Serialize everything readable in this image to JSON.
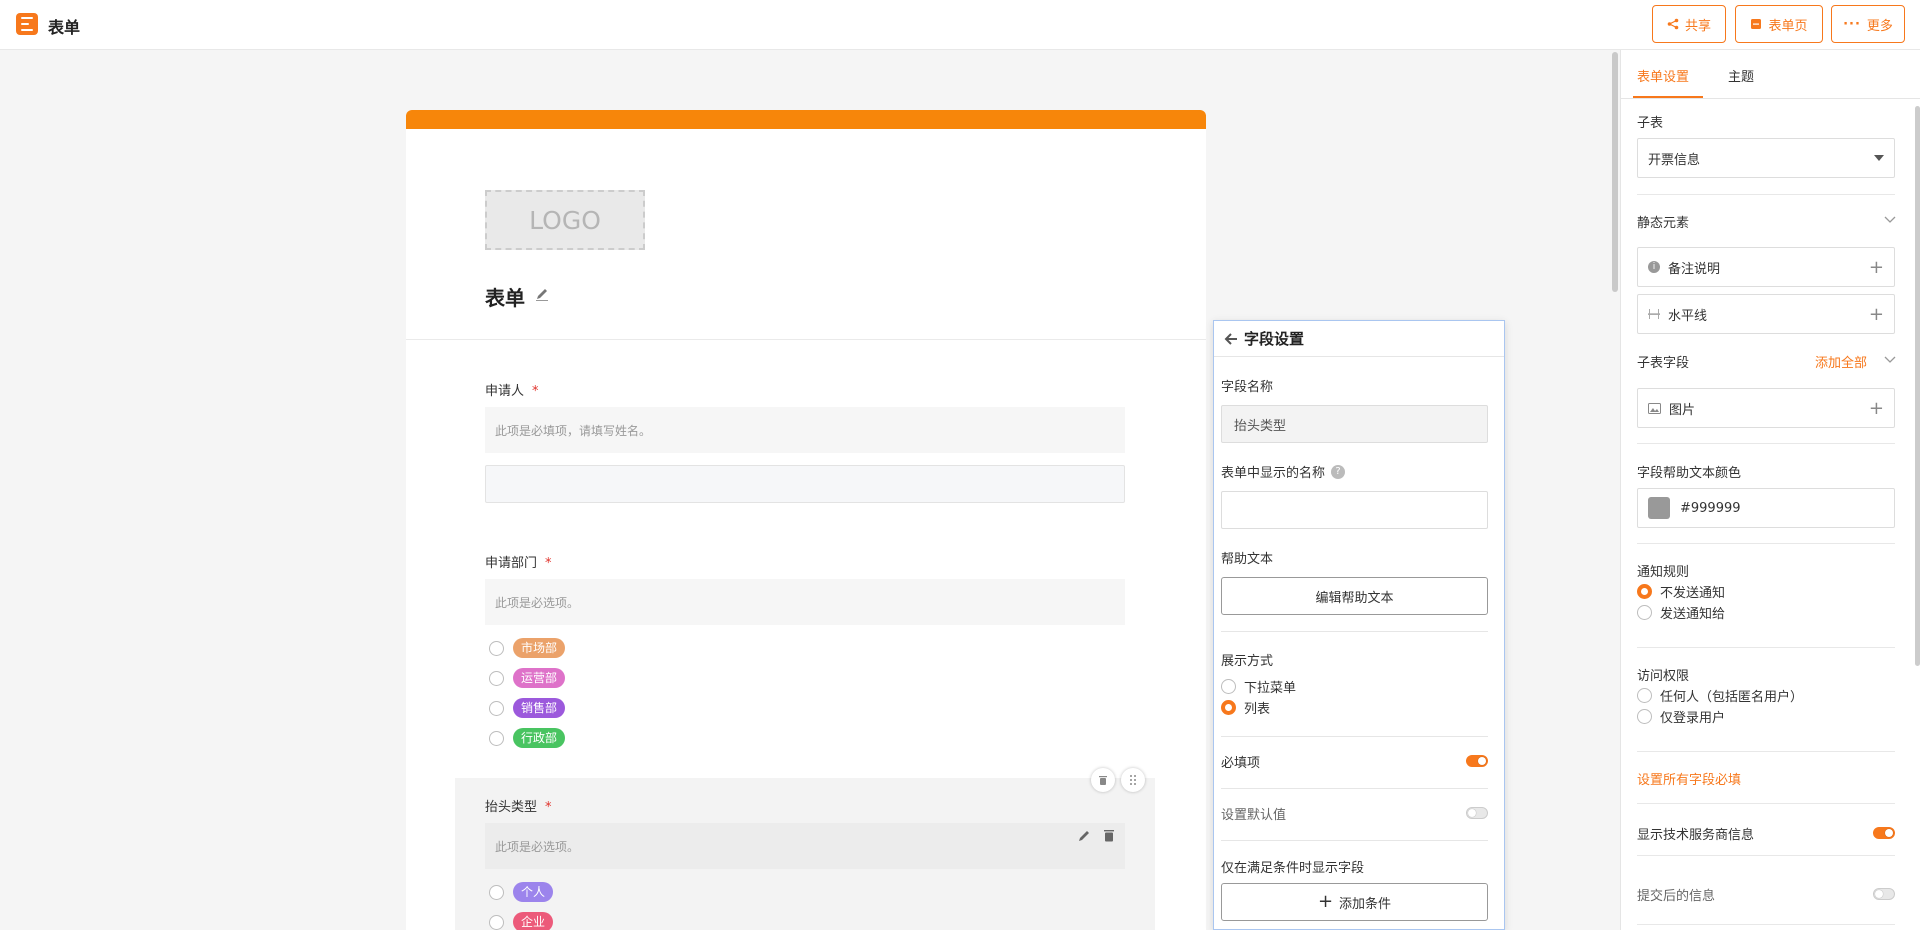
{
  "header": {
    "title": "表单",
    "buttons": {
      "share": "共享",
      "form_page": "表单页",
      "more": "更多"
    }
  },
  "form": {
    "logo_text": "LOGO",
    "title": "表单",
    "required_mark": "*",
    "fields": {
      "applicant": {
        "label": "申请人",
        "help": "此项是必填项，请填写姓名。"
      },
      "department": {
        "label": "申请部门",
        "help": "此项是必选项。",
        "options": [
          {
            "label": "市场部",
            "color": "#eba26a"
          },
          {
            "label": "运营部",
            "color": "#de72c9"
          },
          {
            "label": "销售部",
            "color": "#9c59dc"
          },
          {
            "label": "行政部",
            "color": "#49c461"
          }
        ]
      },
      "header_type": {
        "label": "抬头类型",
        "help": "此项是必选项。",
        "options": [
          {
            "label": "个人",
            "color": "#9c84ec"
          },
          {
            "label": "企业",
            "color": "#ec5a7a"
          }
        ]
      }
    }
  },
  "field_panel": {
    "title": "字段设置",
    "name_label": "字段名称",
    "name_value": "抬头类型",
    "display_name_label": "表单中显示的名称",
    "display_name_value": "",
    "help_text_label": "帮助文本",
    "edit_help_button": "编辑帮助文本",
    "display_mode_label": "展示方式",
    "display_modes": [
      "下拉菜单",
      "列表"
    ],
    "display_mode_selected": "列表",
    "required_label": "必填项",
    "required_on": true,
    "default_label": "设置默认值",
    "default_on": false,
    "condition_label": "仅在满足条件时显示字段",
    "add_condition_button": "添加条件"
  },
  "sidebar": {
    "tabs": [
      "表单设置",
      "主题"
    ],
    "active_tab": "表单设置",
    "subtable_label": "子表",
    "subtable_value": "开票信息",
    "static_label": "静态元素",
    "static_items": [
      "备注说明",
      "水平线"
    ],
    "subtable_fields_label": "子表字段",
    "add_all_label": "添加全部",
    "subtable_field_items": [
      "图片"
    ],
    "help_color_label": "字段帮助文本颜色",
    "help_color_value": "#999999",
    "notify_label": "通知规则",
    "notify_options": [
      "不发送通知",
      "发送通知给"
    ],
    "notify_selected": "不发送通知",
    "access_label": "访问权限",
    "access_options": [
      "任何人（包括匿名用户）",
      "仅登录用户"
    ],
    "set_all_required": "设置所有字段必填",
    "show_provider_label": "显示技术服务商信息",
    "show_provider_on": true,
    "after_submit_label": "提交后的信息",
    "after_submit_on": false
  },
  "colors": {
    "accent": "#f7781c",
    "accent_bar": "#f7860a",
    "help_text": "#999999"
  }
}
